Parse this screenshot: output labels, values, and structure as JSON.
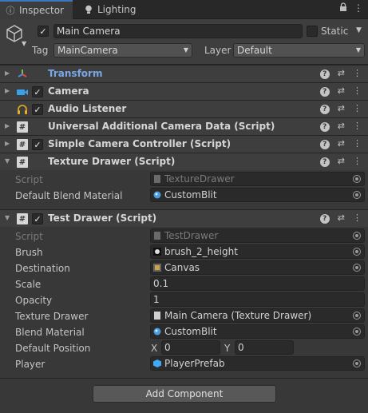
{
  "tabs": [
    {
      "label": "Inspector",
      "icon": "info-icon",
      "active": true
    },
    {
      "label": "Lighting",
      "icon": "lightbulb-icon",
      "active": false
    }
  ],
  "header": {
    "object_name": "Main Camera",
    "active_checked": true,
    "static_label": "Static",
    "static_checked": false,
    "tag_label": "Tag",
    "tag_value": "MainCamera",
    "layer_label": "Layer",
    "layer_value": "Default"
  },
  "components": {
    "transform": {
      "title": "Transform"
    },
    "camera": {
      "title": "Camera"
    },
    "audio_listener": {
      "title": "Audio Listener"
    },
    "ucad": {
      "title": "Universal Additional Camera Data (Script)"
    },
    "scc": {
      "title": "Simple Camera Controller (Script)"
    },
    "texture_drawer": {
      "title": "Texture Drawer (Script)",
      "script_label": "Script",
      "script_value": "TextureDrawer",
      "blend_label": "Default Blend Material",
      "blend_value": "CustomBlit"
    },
    "test_drawer": {
      "title": "Test Drawer (Script)",
      "script_label": "Script",
      "script_value": "TestDrawer",
      "brush_label": "Brush",
      "brush_value": "brush_2_height",
      "destination_label": "Destination",
      "destination_value": "Canvas",
      "scale_label": "Scale",
      "scale_value": "0.1",
      "opacity_label": "Opacity",
      "opacity_value": "1",
      "texture_drawer_label": "Texture Drawer",
      "texture_drawer_value": "Main Camera (Texture Drawer)",
      "blend_label": "Blend Material",
      "blend_value": "CustomBlit",
      "default_pos_label": "Default Position",
      "x_label": "X",
      "x_value": "0",
      "y_label": "Y",
      "y_value": "0",
      "player_label": "Player",
      "player_value": "PlayerPrefab"
    }
  },
  "add_component_label": "Add Component",
  "colors": {
    "accent": "#3a79bb",
    "transform_title": "#7aa7e6"
  }
}
